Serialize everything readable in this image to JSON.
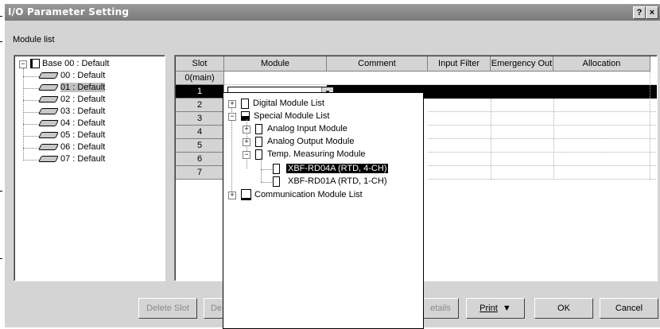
{
  "window": {
    "title": "I/O Parameter Setting",
    "help_btn": "?",
    "close_btn": "×"
  },
  "module_list_label": "Module list",
  "tree": {
    "base": "Base 00 : Default",
    "slots": [
      "00 : Default",
      "01 : Default",
      "02 : Default",
      "03 : Default",
      "04 : Default",
      "05 : Default",
      "06 : Default",
      "07 : Default"
    ],
    "selected_index": 1
  },
  "grid": {
    "headers": [
      "Slot",
      "Module",
      "Comment",
      "Input Filter",
      "Emergency Out",
      "Allocation"
    ],
    "rows": [
      "0(main)",
      "1",
      "2",
      "3",
      "4",
      "5",
      "6",
      "7"
    ],
    "selected_row": 1
  },
  "dropdown": {
    "digital": "Digital Module List",
    "special": "Special Module List",
    "analog_in": "Analog Input Module",
    "analog_out": "Analog Output Module",
    "temp": "Temp. Measuring Module",
    "rd04a": "XBF-RD04A (RTD, 4-CH)",
    "rd01a": "XBF-RD01A (RTD, 1-CH)",
    "comm": "Communication Module List"
  },
  "buttons": {
    "delete_slot": "Delete Slot",
    "de": "De",
    "details": "etails",
    "print": "Print",
    "print_arrow": "▼",
    "ok": "OK",
    "cancel": "Cancel"
  }
}
